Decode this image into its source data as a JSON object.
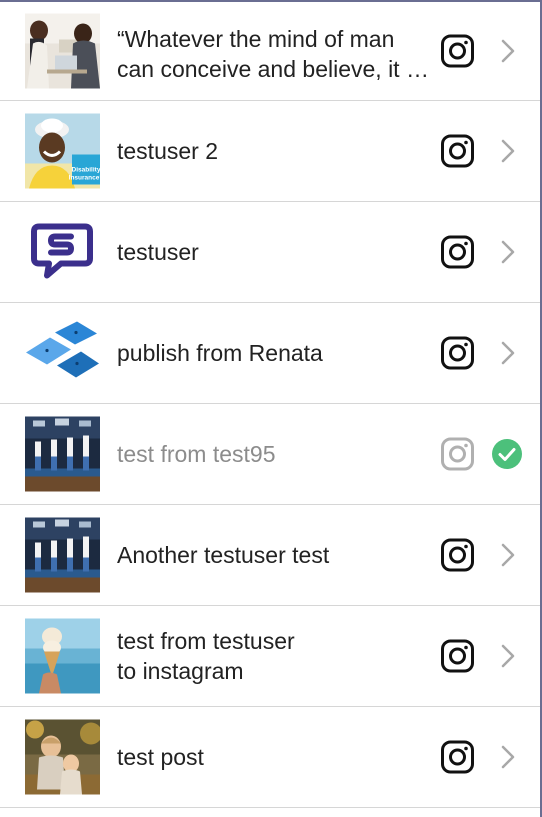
{
  "posts": [
    {
      "lines": [
        "“Whatever the mind of man",
        "can conceive and believe, it c..."
      ],
      "thumb": "meeting-photo-thumbnail",
      "platform_icon": "instagram-icon",
      "status": "pending"
    },
    {
      "lines": [
        "testuser 2"
      ],
      "thumb": "disability-insurance-photo-thumbnail",
      "thumb_caption": [
        "Disability",
        "Insurance?"
      ],
      "platform_icon": "instagram-icon",
      "status": "pending"
    },
    {
      "lines": [
        "testuser"
      ],
      "thumb": "chat-logo-thumbnail",
      "platform_icon": "instagram-icon",
      "status": "pending"
    },
    {
      "lines": [
        "publish from Renata"
      ],
      "thumb": "blue-tiles-logo-thumbnail",
      "platform_icon": "instagram-icon",
      "status": "pending"
    },
    {
      "lines": [
        "test from test95"
      ],
      "thumb": "basketball-arena-photo-thumbnail",
      "platform_icon": "instagram-icon",
      "status": "published"
    },
    {
      "lines": [
        "Another testuser test"
      ],
      "thumb": "basketball-arena-photo-thumbnail",
      "platform_icon": "instagram-icon",
      "status": "pending"
    },
    {
      "lines": [
        "test from testuser",
        "to instagram"
      ],
      "thumb": "ice-cream-beach-photo-thumbnail",
      "platform_icon": "instagram-icon",
      "status": "pending"
    },
    {
      "lines": [
        "test post"
      ],
      "thumb": "children-autumn-photo-thumbnail",
      "platform_icon": "instagram-icon",
      "status": "pending"
    }
  ],
  "colors": {
    "text": "#222222",
    "text_done": "#8c8c8c",
    "divider": "#d6d6d6",
    "chevron": "#a8a8a8",
    "success": "#4cc07b",
    "logo_purple": "#3b2f8c",
    "tile_blue": "#2b86d6"
  }
}
